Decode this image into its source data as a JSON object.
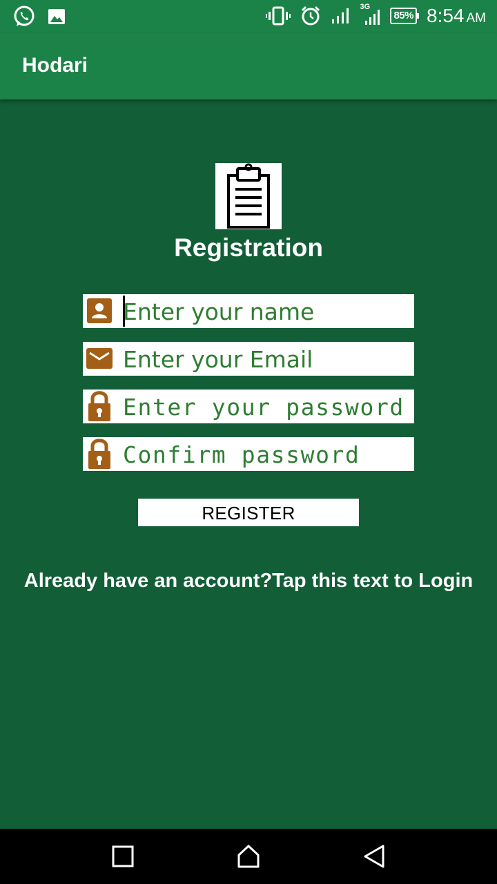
{
  "status_bar": {
    "left_icons": [
      "whatsapp-icon",
      "image-icon"
    ],
    "right_icons": [
      "vibrate-icon",
      "alarm-icon",
      "signal-icon",
      "signal-3g-icon",
      "battery-icon"
    ],
    "network_label": "3G",
    "battery": "85%",
    "time": "8:54",
    "ampm": "AM"
  },
  "app_bar": {
    "title": "Hodari"
  },
  "form": {
    "title": "Registration",
    "logo_icon": "clipboard-icon",
    "fields": [
      {
        "icon": "person-icon",
        "placeholder": "Enter your name"
      },
      {
        "icon": "email-icon",
        "placeholder": "Enter your Email"
      },
      {
        "icon": "lock-icon",
        "placeholder": "Enter your password"
      },
      {
        "icon": "lock-icon",
        "placeholder": "Confirm password"
      }
    ],
    "register_label": "REGISTER",
    "login_text": "Already have an account?Tap this text to Login"
  },
  "nav_bar": {
    "buttons": [
      "recent-apps-icon",
      "home-icon",
      "back-icon"
    ]
  },
  "colors": {
    "background": "#125e37",
    "app_bar": "#1b8347",
    "placeholder": "#2e7d32",
    "icon": "#a35f16"
  }
}
